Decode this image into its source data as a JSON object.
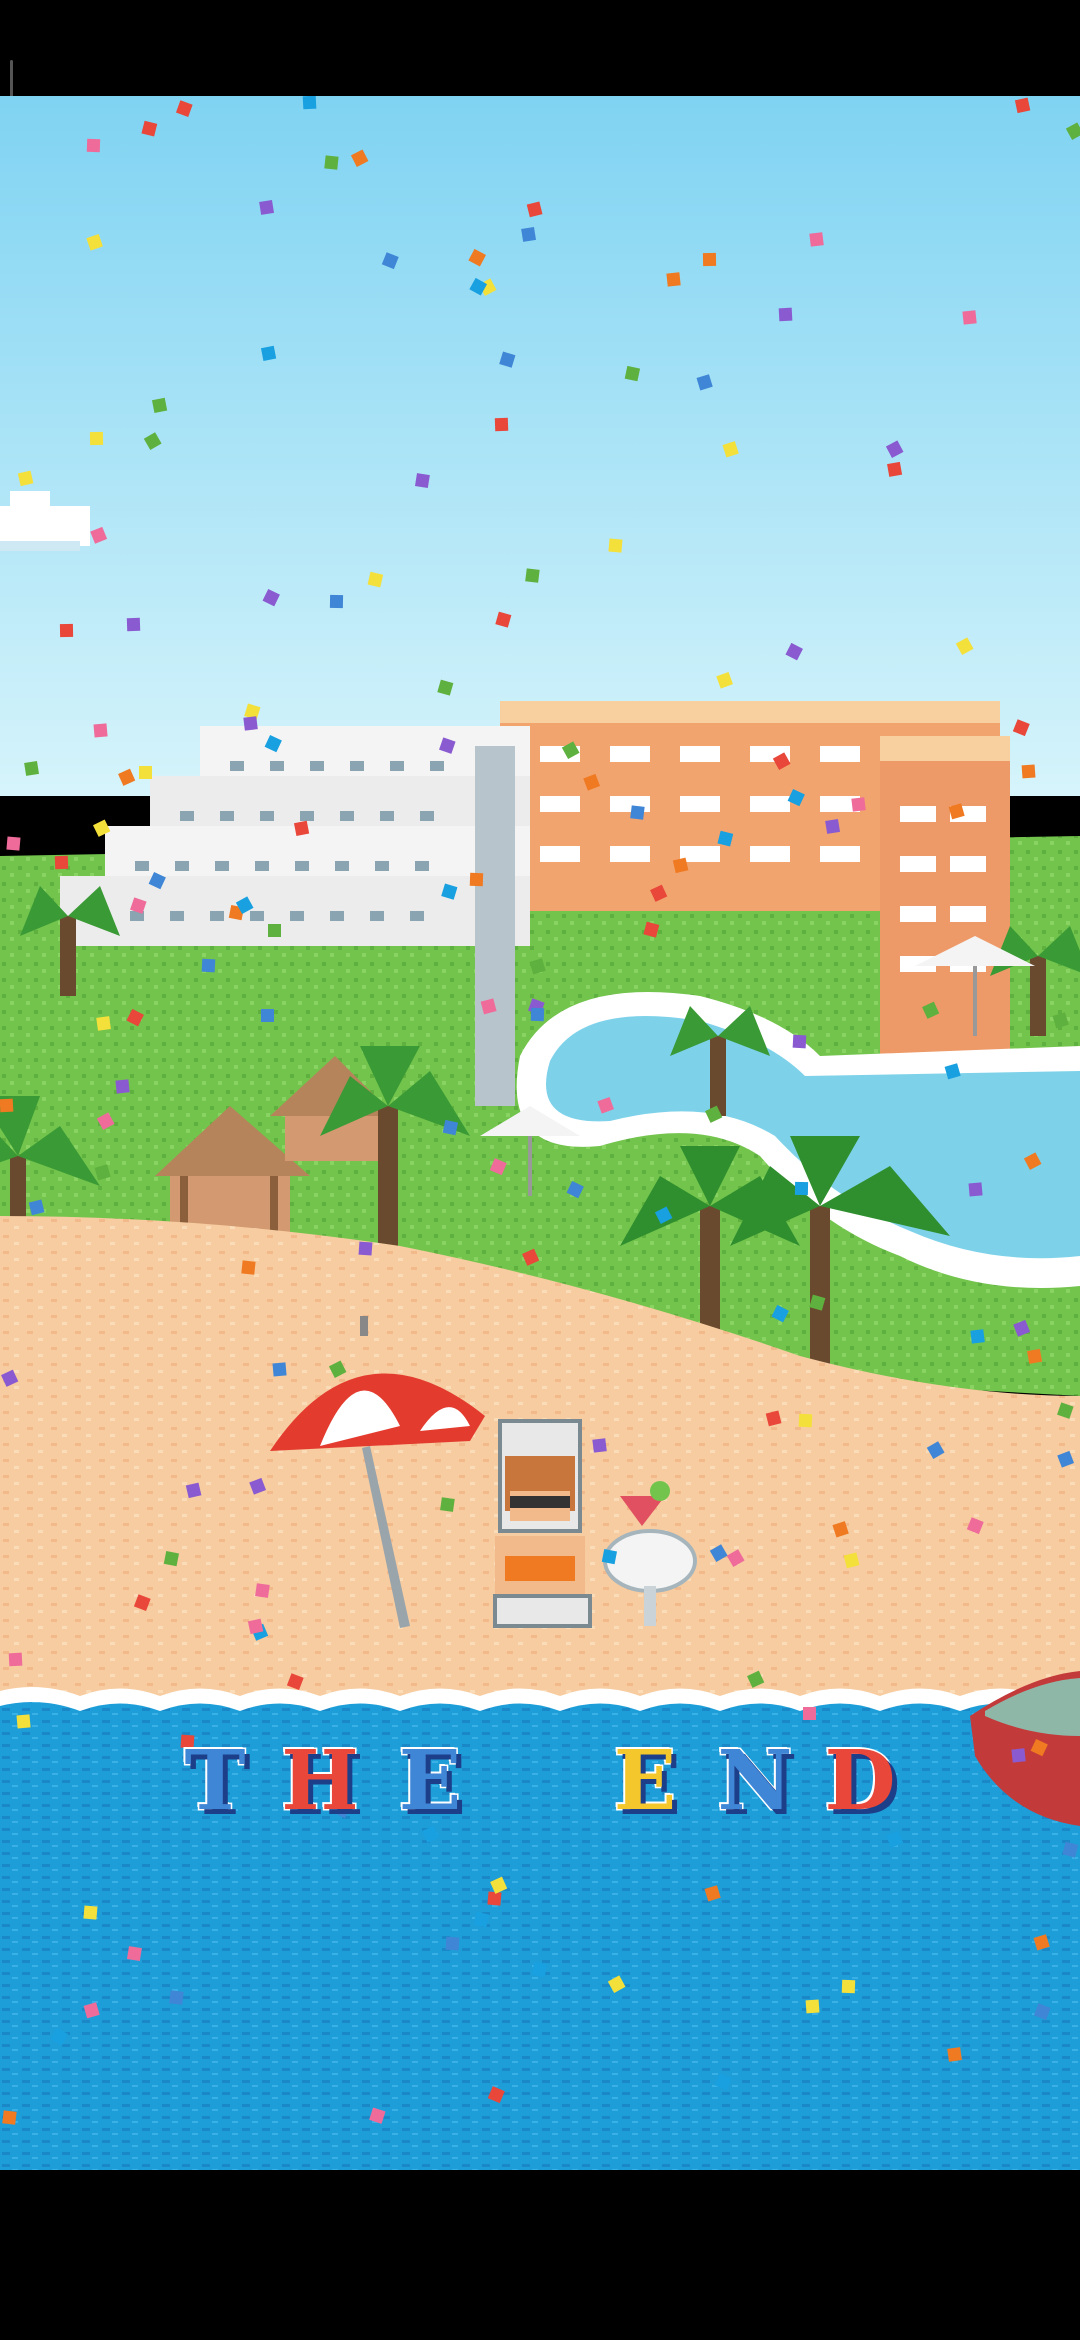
{
  "screen": "ending",
  "title_letters": [
    "T",
    "H",
    "E",
    "E",
    "N",
    "D"
  ],
  "colors": {
    "sky_top": "#86d6f3",
    "sky_bottom": "#c8f0fb",
    "grass": "#6fc04a",
    "sand": "#f6c99c",
    "sea": "#1e9ed9",
    "sea_dark": "#1676b5",
    "letter_colors": [
      "#3f86d6",
      "#e8473a",
      "#3f86d6",
      "#f4c72d",
      "#3f86d6",
      "#e8473a"
    ]
  }
}
